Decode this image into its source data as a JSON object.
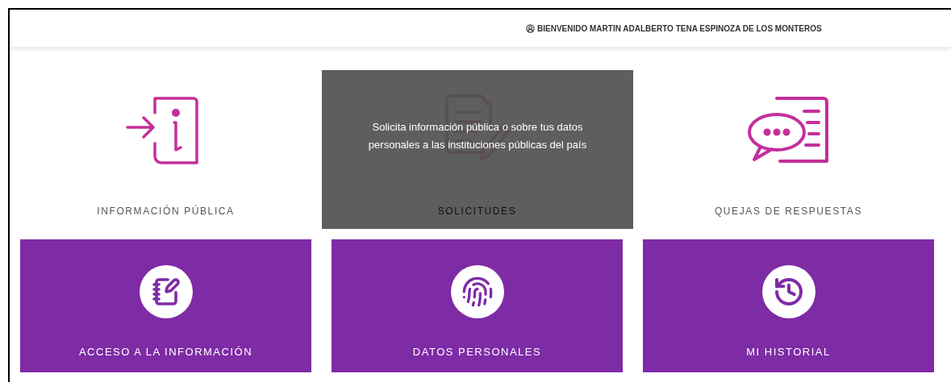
{
  "header": {
    "welcome": "BIENVENIDO MARTIN ADALBERTO TENA ESPINOZA DE LOS MONTEROS"
  },
  "services": [
    {
      "kind": "info",
      "label": "INFORMACIÓN PÚBLICA"
    },
    {
      "kind": "requests",
      "label": "SOLICITUDES",
      "tooltip": "Solicita información pública o sobre tus datos personales a las instituciones públicas del país"
    },
    {
      "kind": "complaints",
      "label": "QUEJAS DE RESPUESTAS"
    }
  ],
  "tiles": [
    {
      "kind": "access",
      "label": "ACCESO A LA INFORMACIÓN"
    },
    {
      "kind": "personal",
      "label": "DATOS PERSONALES"
    },
    {
      "kind": "history",
      "label": "MI HISTORIAL"
    }
  ]
}
